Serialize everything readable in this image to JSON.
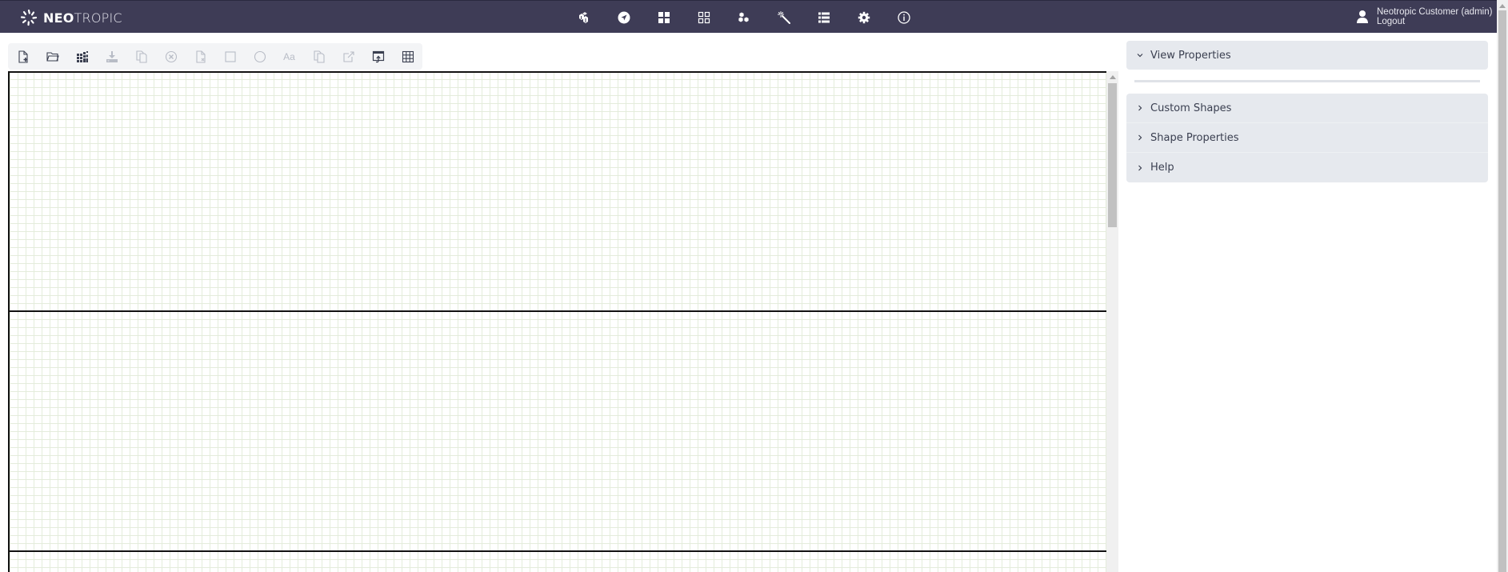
{
  "header": {
    "logo": {
      "bold": "NEO",
      "light": "TROPIC",
      "icon": "neotropic-logo-icon"
    },
    "nav": [
      {
        "name": "nav-inventory",
        "icon": "cubes-icon",
        "title": "Inventory"
      },
      {
        "name": "nav-navigation",
        "icon": "compass-icon",
        "title": "Navigation"
      },
      {
        "name": "nav-dashboard",
        "icon": "grid-filled-icon",
        "title": "Dashboard"
      },
      {
        "name": "nav-modules",
        "icon": "grid-outline-icon",
        "title": "Modules"
      },
      {
        "name": "nav-services",
        "icon": "hexagons-icon",
        "title": "Services"
      },
      {
        "name": "nav-tools",
        "icon": "magic-wand-icon",
        "title": "Tools"
      },
      {
        "name": "nav-lists",
        "icon": "list-icon",
        "title": "Lists"
      },
      {
        "name": "nav-settings",
        "icon": "gear-icon",
        "title": "Settings"
      },
      {
        "name": "nav-about",
        "icon": "info-icon",
        "title": "About"
      }
    ],
    "user": {
      "name": "Neotropic Customer (admin)",
      "logout": "Logout",
      "icon": "user-icon"
    }
  },
  "toolbar": {
    "buttons": [
      {
        "name": "new-view-button",
        "icon": "new-file-icon",
        "enabled": true
      },
      {
        "name": "open-view-button",
        "icon": "folder-open-icon",
        "enabled": true
      },
      {
        "name": "templates-button",
        "icon": "tiles-icon",
        "enabled": true
      },
      {
        "name": "save-button",
        "icon": "download-icon",
        "enabled": false
      },
      {
        "name": "copy-button",
        "icon": "copy-icon",
        "enabled": false
      },
      {
        "name": "delete-button",
        "icon": "circle-x-icon",
        "enabled": false
      },
      {
        "name": "remove-view-button",
        "icon": "file-x-icon",
        "enabled": false
      },
      {
        "name": "rectangle-tool-button",
        "icon": "square-icon",
        "enabled": false
      },
      {
        "name": "ellipse-tool-button",
        "icon": "circle-icon",
        "enabled": false
      },
      {
        "name": "text-tool-button",
        "icon": "text-icon",
        "enabled": false,
        "label": "Aa"
      },
      {
        "name": "duplicate-button",
        "icon": "copy-icon",
        "enabled": false
      },
      {
        "name": "export-button",
        "icon": "external-link-icon",
        "enabled": false
      },
      {
        "name": "import-button",
        "icon": "window-import-icon",
        "enabled": true
      },
      {
        "name": "grid-toggle-button",
        "icon": "table-grid-icon",
        "enabled": true
      }
    ]
  },
  "panel": {
    "sections": [
      {
        "label": "View Properties",
        "expanded": true
      },
      {
        "label": "Custom Shapes",
        "expanded": false
      },
      {
        "label": "Shape Properties",
        "expanded": false
      },
      {
        "label": "Help",
        "expanded": false
      }
    ]
  },
  "colors": {
    "header_bg": "#3e3c56",
    "panel_bg": "#e6e9ee",
    "grid_line": "#e4ecdc",
    "icon_enabled": "#3a3f50",
    "icon_disabled": "#b8bcc6"
  }
}
